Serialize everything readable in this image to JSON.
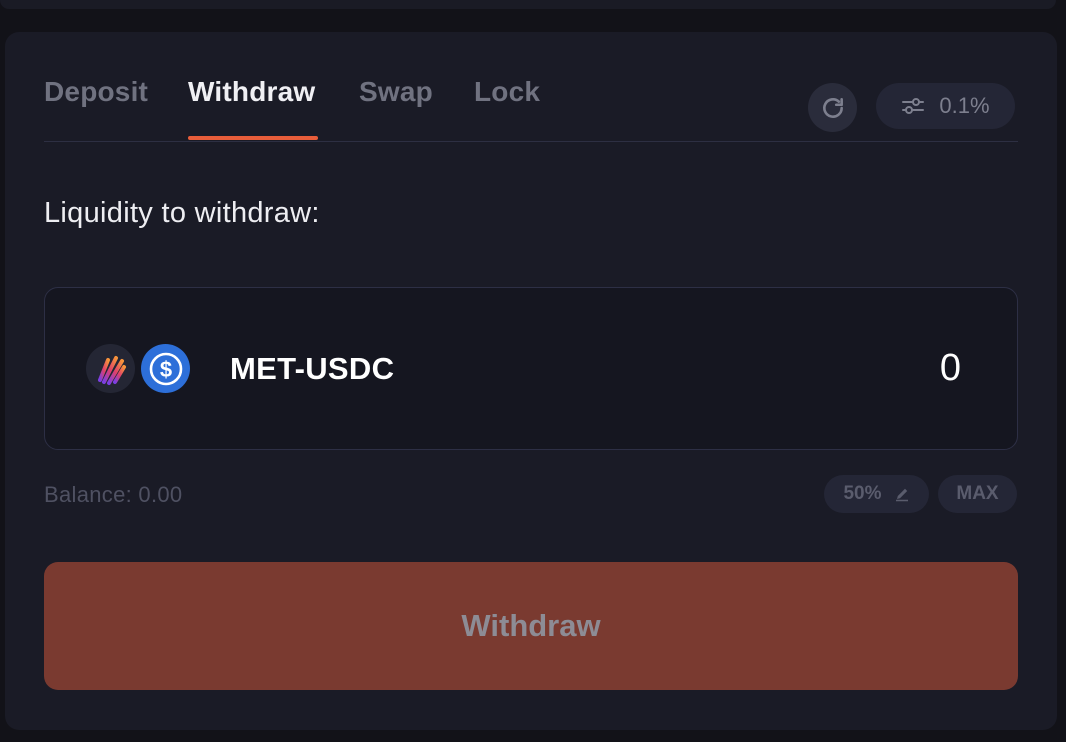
{
  "tabs": [
    {
      "label": "Deposit",
      "active": false
    },
    {
      "label": "Withdraw",
      "active": true
    },
    {
      "label": "Swap",
      "active": false
    },
    {
      "label": "Lock",
      "active": false
    }
  ],
  "slippage": {
    "value": "0.1%"
  },
  "withdraw_section": {
    "label": "Liquidity to withdraw:",
    "pair_name": "MET-USDC",
    "amount": "0",
    "balance_text": "Balance: 0.00",
    "percent_label": "50%",
    "max_label": "MAX"
  },
  "action_button": {
    "label": "Withdraw"
  },
  "colors": {
    "accent": "#e85d3a",
    "card_background": "#1a1b26",
    "button_background": "#7a3a30",
    "usdc_blue": "#2d6fd9"
  },
  "icons": {
    "refresh": "refresh-icon",
    "slippage": "sliders-icon",
    "met_token": "met-token-icon",
    "usdc_token": "usdc-token-icon",
    "edit": "pencil-icon"
  }
}
